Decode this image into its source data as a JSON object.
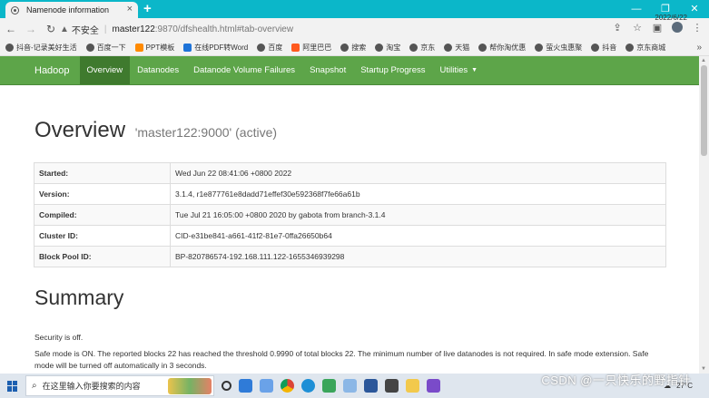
{
  "browser": {
    "tab_title": "Namenode information",
    "new_tab": "+",
    "win_min": "—",
    "win_max": "❐",
    "win_close": "✕",
    "not_secure": "不安全",
    "url_host": "master122",
    "url_rest": ":9870/dfshealth.html#tab-overview",
    "bookmarks": [
      {
        "label": "抖音-记录美好生活",
        "icon": "tiktok-icon"
      },
      {
        "label": "百度一下",
        "icon": "globe-icon"
      },
      {
        "label": "PPT模板",
        "icon": "ppt-icon"
      },
      {
        "label": "在线PDF转Word",
        "icon": "pdf-icon"
      },
      {
        "label": "百度",
        "icon": "globe-icon"
      },
      {
        "label": "阿里巴巴",
        "icon": "alibaba-icon"
      },
      {
        "label": "搜索",
        "icon": "globe-icon"
      },
      {
        "label": "淘宝",
        "icon": "globe-icon"
      },
      {
        "label": "京东",
        "icon": "globe-icon"
      },
      {
        "label": "天猫",
        "icon": "globe-icon"
      },
      {
        "label": "帮你淘优惠",
        "icon": "globe-icon"
      },
      {
        "label": "萤火虫惠聚",
        "icon": "globe-icon"
      },
      {
        "label": "抖音",
        "icon": "globe-icon"
      },
      {
        "label": "京东商城",
        "icon": "globe-icon"
      }
    ]
  },
  "nav": {
    "brand": "Hadoop",
    "items": [
      {
        "label": "Overview",
        "active": true
      },
      {
        "label": "Datanodes",
        "active": false
      },
      {
        "label": "Datanode Volume Failures",
        "active": false
      },
      {
        "label": "Snapshot",
        "active": false
      },
      {
        "label": "Startup Progress",
        "active": false
      },
      {
        "label": "Utilities",
        "active": false,
        "dropdown": true
      }
    ]
  },
  "overview": {
    "title": "Overview",
    "subtitle": "'master122:9000' (active)",
    "rows": [
      {
        "key": "Started:",
        "value": "Wed Jun 22 08:41:06 +0800 2022"
      },
      {
        "key": "Version:",
        "value": "3.1.4, r1e877761e8dadd71effef30e592368f7fe66a61b"
      },
      {
        "key": "Compiled:",
        "value": "Tue Jul 21 16:05:00 +0800 2020 by gabota from branch-3.1.4"
      },
      {
        "key": "Cluster ID:",
        "value": "CID-e31be841-a661-41f2-81e7-0ffa26650b64"
      },
      {
        "key": "Block Pool ID:",
        "value": "BP-820786574-192.168.111.122-1655346939298"
      }
    ]
  },
  "summary": {
    "title": "Summary",
    "security": "Security is off.",
    "safemode": "Safe mode is ON. The reported blocks 22 has reached the threshold 0.9990 of total blocks 22. The minimum number of live datanodes is not required. In safe mode extension. Safe mode will be turned off automatically in 3 seconds."
  },
  "taskbar": {
    "search_placeholder": "在这里输入你要搜索的内容",
    "temperature": "27°C",
    "date": "2022/6/22",
    "watermark": "CSDN @一只快乐的野指针"
  }
}
